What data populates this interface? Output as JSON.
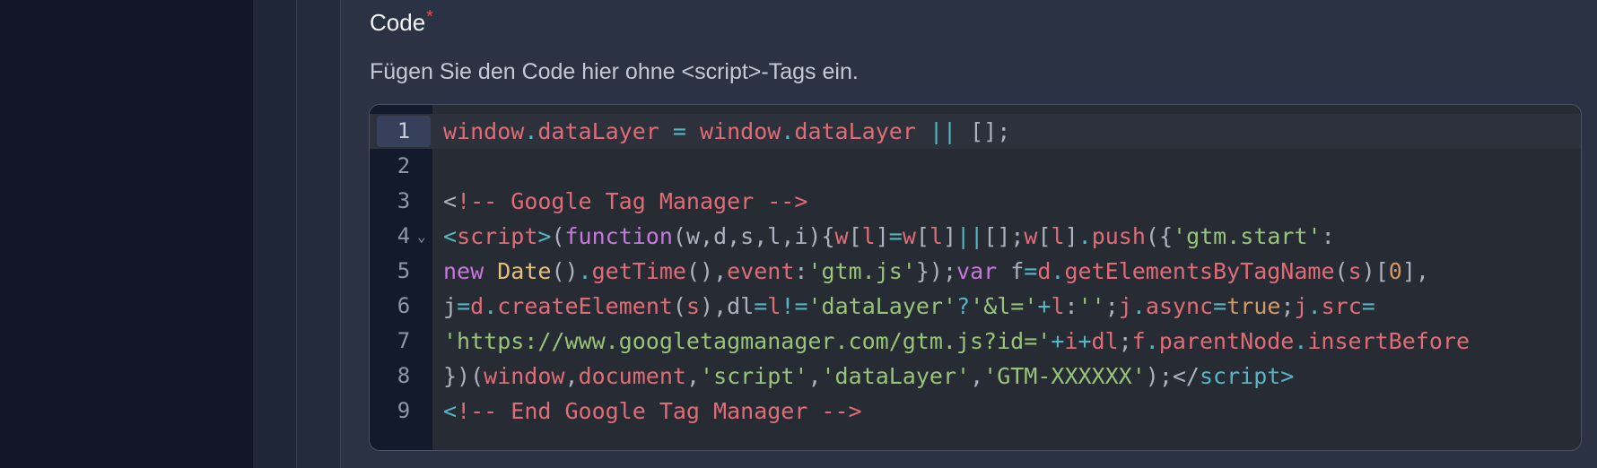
{
  "field": {
    "label": "Code",
    "required_mark": "*",
    "help": "Fügen Sie den Code hier ohne <script>-Tags ein."
  },
  "editor": {
    "active_line": 1,
    "lines": [
      {
        "number": "1",
        "tokens": [
          [
            "r",
            "window"
          ],
          [
            "c",
            "."
          ],
          [
            "r",
            "dataLayer"
          ],
          [
            "t",
            " "
          ],
          [
            "c",
            "="
          ],
          [
            "t",
            " "
          ],
          [
            "r",
            "window"
          ],
          [
            "c",
            "."
          ],
          [
            "r",
            "dataLayer"
          ],
          [
            "t",
            " "
          ],
          [
            "c",
            "||"
          ],
          [
            "t",
            " [];"
          ]
        ]
      },
      {
        "number": "2",
        "tokens": []
      },
      {
        "number": "3",
        "tokens": [
          [
            "t",
            "<"
          ],
          [
            "r",
            "!-- Google Tag Manager -->"
          ]
        ]
      },
      {
        "number": "4",
        "fold": true,
        "tokens": [
          [
            "c",
            "<"
          ],
          [
            "r",
            "script"
          ],
          [
            "c",
            ">"
          ],
          [
            "t",
            "("
          ],
          [
            "p",
            "function"
          ],
          [
            "t",
            "(w,d,s,l,i){"
          ],
          [
            "r",
            "w"
          ],
          [
            "t",
            "["
          ],
          [
            "r",
            "l"
          ],
          [
            "t",
            "]"
          ],
          [
            "c",
            "="
          ],
          [
            "r",
            "w"
          ],
          [
            "t",
            "["
          ],
          [
            "r",
            "l"
          ],
          [
            "t",
            "]"
          ],
          [
            "c",
            "||"
          ],
          [
            "t",
            "[];"
          ],
          [
            "r",
            "w"
          ],
          [
            "t",
            "["
          ],
          [
            "r",
            "l"
          ],
          [
            "t",
            "]"
          ],
          [
            "c",
            "."
          ],
          [
            "r",
            "push"
          ],
          [
            "t",
            "({"
          ],
          [
            "g",
            "'gtm.start'"
          ],
          [
            "t",
            ":"
          ]
        ]
      },
      {
        "number": "5",
        "tokens": [
          [
            "p",
            "new"
          ],
          [
            "t",
            " "
          ],
          [
            "y",
            "Date"
          ],
          [
            "t",
            "()"
          ],
          [
            "c",
            "."
          ],
          [
            "r",
            "getTime"
          ],
          [
            "t",
            "(),"
          ],
          [
            "r",
            "event"
          ],
          [
            "t",
            ":"
          ],
          [
            "g",
            "'gtm.js'"
          ],
          [
            "t",
            "});"
          ],
          [
            "p",
            "var"
          ],
          [
            "t",
            " f"
          ],
          [
            "c",
            "="
          ],
          [
            "r",
            "d"
          ],
          [
            "c",
            "."
          ],
          [
            "r",
            "getElementsByTagName"
          ],
          [
            "t",
            "("
          ],
          [
            "r",
            "s"
          ],
          [
            "t",
            ")["
          ],
          [
            "o",
            "0"
          ],
          [
            "t",
            "],"
          ]
        ]
      },
      {
        "number": "6",
        "tokens": [
          [
            "t",
            "j"
          ],
          [
            "c",
            "="
          ],
          [
            "r",
            "d"
          ],
          [
            "c",
            "."
          ],
          [
            "r",
            "createElement"
          ],
          [
            "t",
            "("
          ],
          [
            "r",
            "s"
          ],
          [
            "t",
            "),dl"
          ],
          [
            "c",
            "="
          ],
          [
            "r",
            "l"
          ],
          [
            "c",
            "!="
          ],
          [
            "g",
            "'dataLayer'"
          ],
          [
            "c",
            "?"
          ],
          [
            "g",
            "'&l='"
          ],
          [
            "c",
            "+"
          ],
          [
            "r",
            "l"
          ],
          [
            "t",
            ":"
          ],
          [
            "g",
            "''"
          ],
          [
            "t",
            ";"
          ],
          [
            "r",
            "j"
          ],
          [
            "c",
            "."
          ],
          [
            "r",
            "async"
          ],
          [
            "c",
            "="
          ],
          [
            "o",
            "true"
          ],
          [
            "t",
            ";"
          ],
          [
            "r",
            "j"
          ],
          [
            "c",
            "."
          ],
          [
            "r",
            "src"
          ],
          [
            "c",
            "="
          ]
        ]
      },
      {
        "number": "7",
        "tokens": [
          [
            "g",
            "'https://www.googletagmanager.com/gtm.js?id='"
          ],
          [
            "c",
            "+"
          ],
          [
            "r",
            "i"
          ],
          [
            "c",
            "+"
          ],
          [
            "r",
            "dl"
          ],
          [
            "t",
            ";"
          ],
          [
            "r",
            "f"
          ],
          [
            "c",
            "."
          ],
          [
            "r",
            "parentNode"
          ],
          [
            "c",
            "."
          ],
          [
            "r",
            "insertBefore"
          ]
        ]
      },
      {
        "number": "8",
        "tokens": [
          [
            "t",
            "})("
          ],
          [
            "r",
            "window"
          ],
          [
            "t",
            ","
          ],
          [
            "r",
            "document"
          ],
          [
            "t",
            ","
          ],
          [
            "g",
            "'script'"
          ],
          [
            "t",
            ","
          ],
          [
            "g",
            "'dataLayer'"
          ],
          [
            "t",
            ","
          ],
          [
            "g",
            "'GTM-XXXXXX'"
          ],
          [
            "t",
            ");</"
          ],
          [
            "c",
            "script"
          ],
          [
            "c",
            ">"
          ]
        ]
      },
      {
        "number": "9",
        "tokens": [
          [
            "c",
            "<"
          ],
          [
            "r",
            "!-- End Google Tag Manager -->"
          ]
        ]
      }
    ]
  }
}
